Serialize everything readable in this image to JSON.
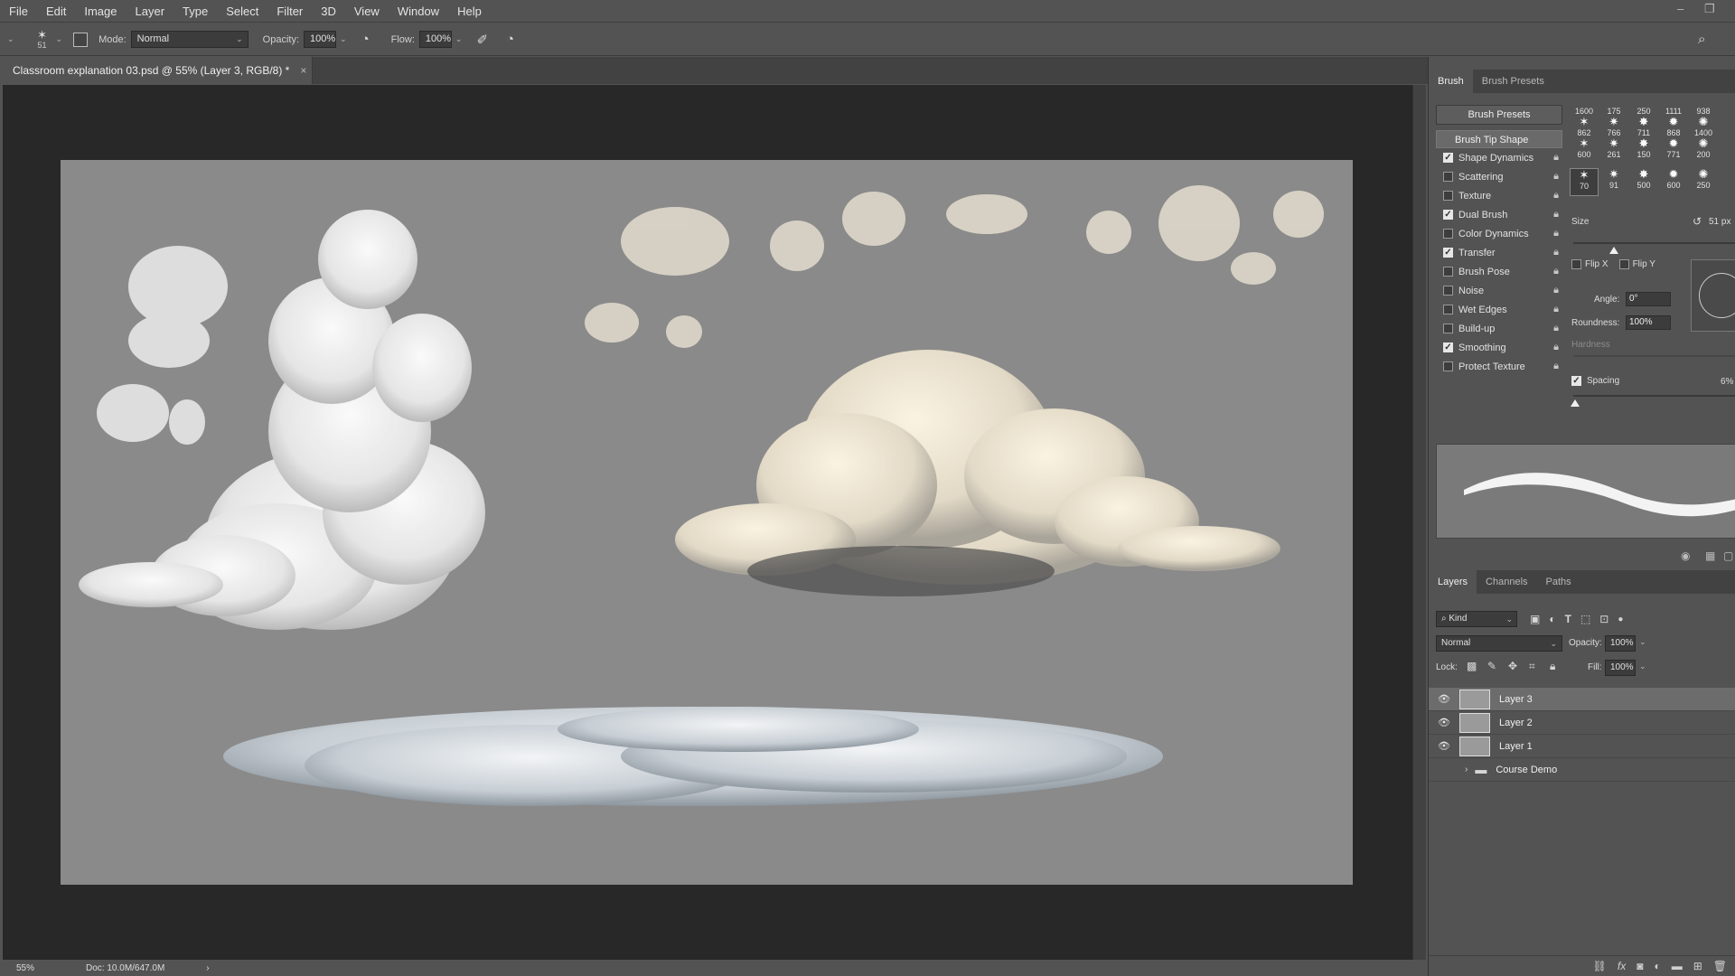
{
  "menubar": {
    "items": [
      "File",
      "Edit",
      "Image",
      "Layer",
      "Type",
      "Select",
      "Filter",
      "3D",
      "View",
      "Window",
      "Help"
    ]
  },
  "options": {
    "brush_size": "51",
    "mode_label": "Mode:",
    "mode_value": "Normal",
    "opacity_label": "Opacity:",
    "opacity_value": "100%",
    "flow_label": "Flow:",
    "flow_value": "100%"
  },
  "document": {
    "tab_title": "Classroom explanation 03.psd @ 55% (Layer 3, RGB/8) *",
    "close_glyph": "×"
  },
  "status": {
    "zoom": "55%",
    "doc_size": "Doc: 10.0M/647.0M",
    "arrow": "›"
  },
  "brush_panel": {
    "tabs": [
      "Brush",
      "Brush Presets"
    ],
    "presets_button": "Brush Presets",
    "tip_shape_header": "Brush Tip Shape",
    "options": [
      {
        "label": "Shape Dynamics",
        "checked": true
      },
      {
        "label": "Scattering",
        "checked": false
      },
      {
        "label": "Texture",
        "checked": false
      },
      {
        "label": "Dual Brush",
        "checked": true
      },
      {
        "label": "Color Dynamics",
        "checked": false
      },
      {
        "label": "Transfer",
        "checked": true
      },
      {
        "label": "Brush Pose",
        "checked": false
      },
      {
        "label": "Noise",
        "checked": false
      },
      {
        "label": "Wet Edges",
        "checked": false
      },
      {
        "label": "Build-up",
        "checked": false
      },
      {
        "label": "Smoothing",
        "checked": true
      },
      {
        "label": "Protect Texture",
        "checked": false
      }
    ],
    "tips": [
      {
        "top": "1600",
        "bottom": "862"
      },
      {
        "top": "175",
        "bottom": "766"
      },
      {
        "top": "250",
        "bottom": "711"
      },
      {
        "top": "1111",
        "bottom": "868"
      },
      {
        "top": "938",
        "bottom": "1400"
      },
      {
        "top": "",
        "bottom": "600"
      },
      {
        "top": "",
        "bottom": "261"
      },
      {
        "top": "",
        "bottom": "150"
      },
      {
        "top": "",
        "bottom": "771"
      },
      {
        "top": "",
        "bottom": "200"
      },
      {
        "top": "",
        "bottom": "70"
      },
      {
        "top": "",
        "bottom": "91"
      },
      {
        "top": "",
        "bottom": "500"
      },
      {
        "top": "",
        "bottom": "600"
      },
      {
        "top": "",
        "bottom": "250"
      }
    ],
    "size_label": "Size",
    "size_value": "51 px",
    "flip_x": "Flip X",
    "flip_y": "Flip Y",
    "angle_label": "Angle:",
    "angle_value": "0°",
    "roundness_label": "Roundness:",
    "roundness_value": "100%",
    "hardness_label": "Hardness",
    "spacing_label": "Spacing",
    "spacing_value": "6%"
  },
  "layers_panel": {
    "tabs": [
      "Layers",
      "Channels",
      "Paths"
    ],
    "kind_label": "Kind",
    "blend_mode": "Normal",
    "opacity_label": "Opacity:",
    "opacity_value": "100%",
    "lock_label": "Lock:",
    "fill_label": "Fill:",
    "fill_value": "100%",
    "layers": [
      {
        "name": "Layer 3",
        "selected": true
      },
      {
        "name": "Layer 2",
        "selected": false
      },
      {
        "name": "Layer 1",
        "selected": false
      },
      {
        "name": "Course Demo",
        "selected": false,
        "group": true
      }
    ]
  }
}
